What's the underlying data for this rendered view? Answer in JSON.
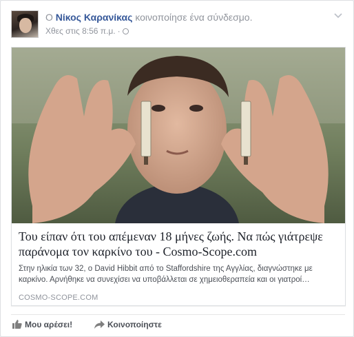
{
  "post": {
    "prefix": "Ο",
    "author": "Νίκος Καρανίκας",
    "action": "κοινοποίησε ένα σύνδεσμο.",
    "timestamp": "Χθες στις 8:56 π.μ.",
    "separator": "·",
    "audience_icon": "globe-icon",
    "options_icon": "chevron-down-icon"
  },
  "attachment": {
    "headline": "Του είπαν ότι του απέμεναν 18 μήνες ζωής. Να πώς γιάτρεψε παράνομα τον καρκίνο του - Cosmo-Scope.com",
    "description": "Στην ηλικία των 32, ο David Hibbit από το Staffordshire της Αγγλίας, διαγνώστηκε με καρκίνο. Αρνήθηκε να συνεχίσει να υποβάλλεται σε χημειοθεραπεία και οι γιατροί…",
    "domain": "COSMO-SCOPE.COM"
  },
  "actions": {
    "like_label": "Μου αρέσει!",
    "share_label": "Κοινοποίηστε"
  },
  "colors": {
    "link_blue": "#365899",
    "meta_gray": "#90949c",
    "action_gray": "#4b4f56"
  }
}
